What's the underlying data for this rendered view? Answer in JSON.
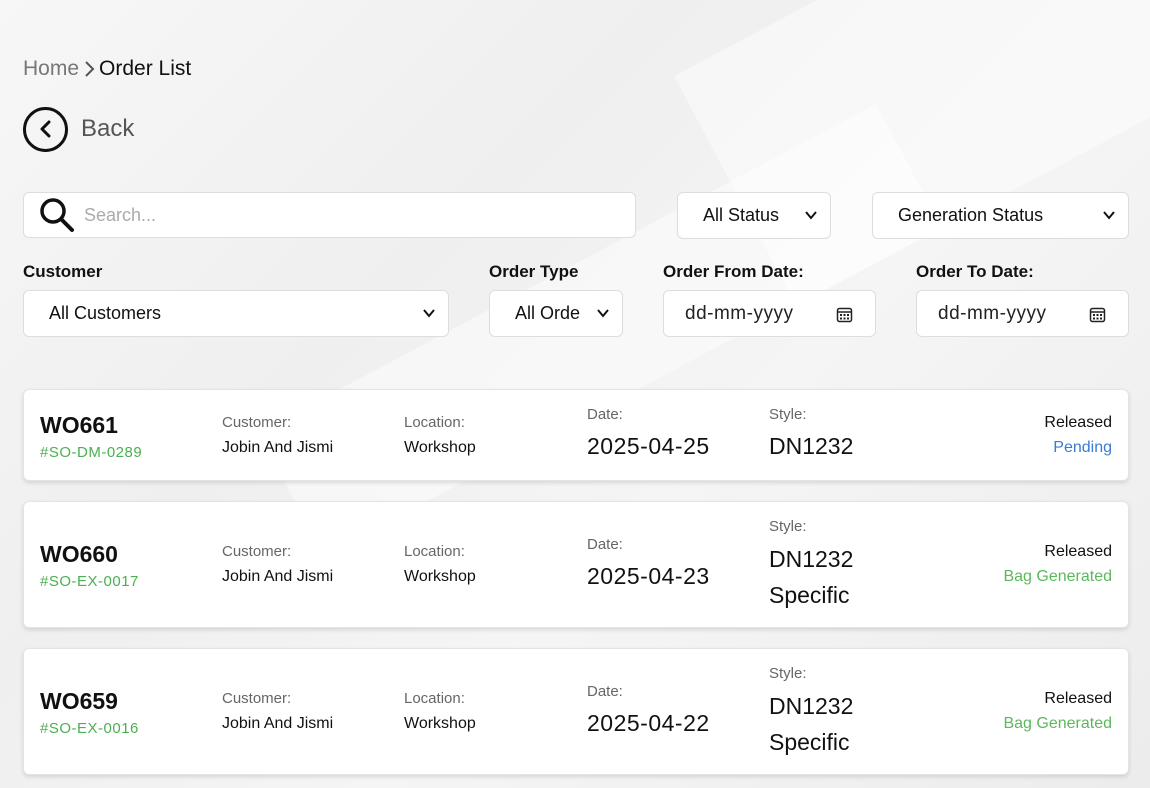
{
  "breadcrumb": {
    "home": "Home",
    "current": "Order List"
  },
  "back_label": "Back",
  "search": {
    "placeholder": "Search..."
  },
  "filters": {
    "status_select": "All Status",
    "generation_select": "Generation Status",
    "customer_label": "Customer",
    "customer_select": "All Customers",
    "order_type_label": "Order Type",
    "order_type_select": "All Orde",
    "from_date_label": "Order From Date:",
    "from_date_value": "dd-mm-yyyy",
    "to_date_label": "Order To Date:",
    "to_date_value": "dd-mm-yyyy"
  },
  "field_labels": {
    "customer": "Customer:",
    "location": "Location:",
    "date": "Date:",
    "style": "Style:"
  },
  "colors": {
    "so_green": "#4caf50",
    "pending_blue": "#3a7bd5",
    "generated_green": "#5cb85c"
  },
  "orders": [
    {
      "wo": "WO661",
      "so": "#SO-DM-0289",
      "customer": "Jobin And Jismi",
      "location": "Workshop",
      "date": "2025-04-25",
      "style_line1": "DN1232",
      "style_line2": "",
      "release": "Released",
      "status": "Pending"
    },
    {
      "wo": "WO660",
      "so": "#SO-EX-0017",
      "customer": "Jobin And Jismi",
      "location": "Workshop",
      "date": "2025-04-23",
      "style_line1": "DN1232",
      "style_line2": "Specific",
      "release": "Released",
      "status": "Bag Generated"
    },
    {
      "wo": "WO659",
      "so": "#SO-EX-0016",
      "customer": "Jobin And Jismi",
      "location": "Workshop",
      "date": "2025-04-22",
      "style_line1": "DN1232",
      "style_line2": "Specific",
      "release": "Released",
      "status": "Bag Generated"
    }
  ]
}
